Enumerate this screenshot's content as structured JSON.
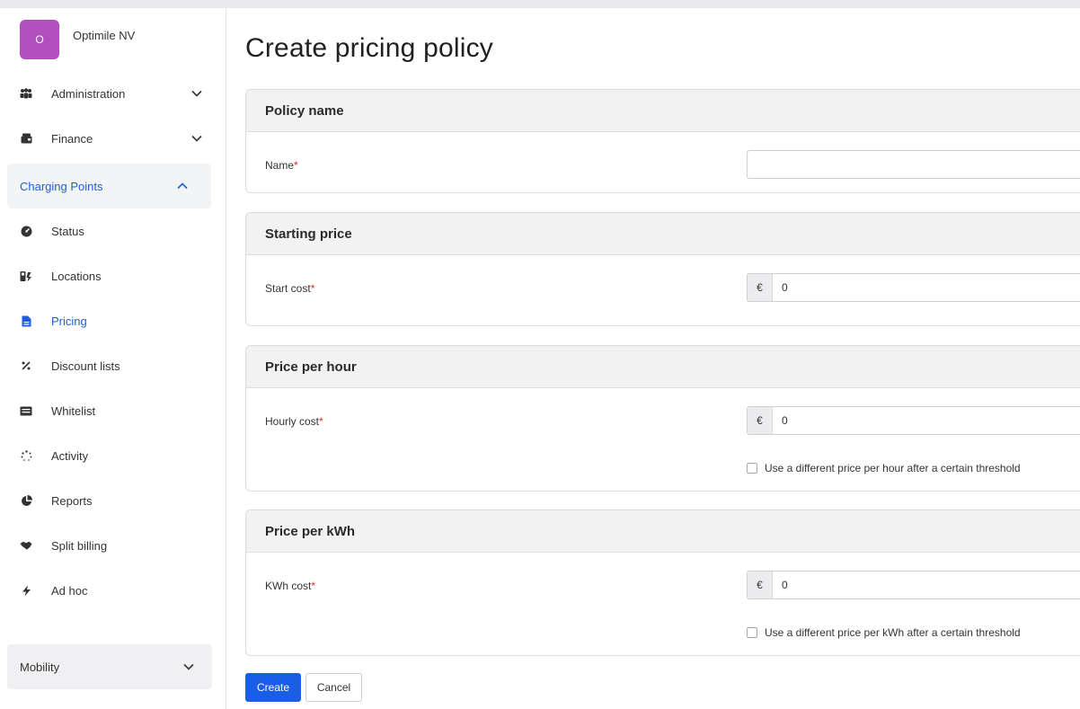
{
  "org": {
    "avatar_letter": "O",
    "name": "Optimile NV"
  },
  "sidebar": {
    "administration": "Administration",
    "finance": "Finance",
    "charging_points": "Charging Points",
    "items": [
      {
        "label": "Status",
        "icon": "gauge-icon"
      },
      {
        "label": "Locations",
        "icon": "locations-icon"
      },
      {
        "label": "Pricing",
        "icon": "document-icon"
      },
      {
        "label": "Discount lists",
        "icon": "percent-icon"
      },
      {
        "label": "Whitelist",
        "icon": "list-icon"
      },
      {
        "label": "Activity",
        "icon": "spinner-icon"
      },
      {
        "label": "Reports",
        "icon": "pie-chart-icon"
      },
      {
        "label": "Split billing",
        "icon": "handshake-icon"
      },
      {
        "label": "Ad hoc",
        "icon": "bolt-icon"
      }
    ],
    "mobility": "Mobility"
  },
  "page": {
    "title": "Create pricing policy"
  },
  "sections": {
    "policy_name": {
      "title": "Policy name",
      "name_label": "Name",
      "required": "*",
      "name_value": ""
    },
    "starting_price": {
      "title": "Starting price",
      "label": "Start cost",
      "required": "*",
      "currency": "€",
      "value": "0"
    },
    "price_per_hour": {
      "title": "Price per hour",
      "label": "Hourly cost",
      "required": "*",
      "currency": "€",
      "value": "0",
      "threshold_label": "Use a different price per hour after a certain threshold"
    },
    "price_per_kwh": {
      "title": "Price per kWh",
      "label": "KWh cost",
      "required": "*",
      "currency": "€",
      "value": "0",
      "threshold_label": "Use a different price per kWh after a certain threshold"
    }
  },
  "actions": {
    "create": "Create",
    "cancel": "Cancel"
  },
  "colors": {
    "accent": "#1a5ee8",
    "avatar": "#b14fbd",
    "active_nav": "#1e5fd9",
    "required": "#d93025"
  }
}
